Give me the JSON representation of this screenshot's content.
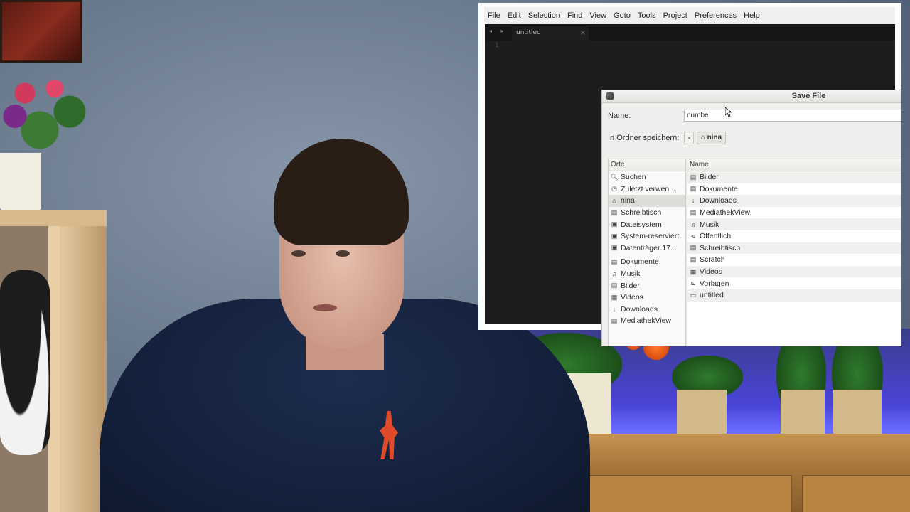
{
  "editor": {
    "menu": [
      "File",
      "Edit",
      "Selection",
      "Find",
      "View",
      "Goto",
      "Tools",
      "Project",
      "Preferences",
      "Help"
    ],
    "tab_nav": "◂ ▸",
    "tab": {
      "label": "untitled",
      "close": "×"
    },
    "line_numbers": [
      "1"
    ]
  },
  "dialog": {
    "title": "Save File",
    "name_label": "Name:",
    "name_value": "numbe",
    "folder_label": "In Ordner speichern:",
    "path_back": "◂",
    "path_current": "nina",
    "places_header": "Orte",
    "files_header": "Name",
    "places": [
      {
        "label": "Suchen",
        "icon": "search-icon"
      },
      {
        "label": "Zuletzt verwen...",
        "icon": "recent-icon"
      },
      {
        "label": "nina",
        "icon": "home-icon",
        "selected": true
      },
      {
        "label": "Schreibtisch",
        "icon": "desktop-folder-icon"
      },
      {
        "label": "Dateisystem",
        "icon": "drive-icon"
      },
      {
        "label": "System-reserviert",
        "icon": "drive-icon"
      },
      {
        "label": "Datenträger 17...",
        "icon": "drive-icon"
      },
      {
        "label": "Dokumente",
        "icon": "folder-icon",
        "separator_before": true
      },
      {
        "label": "Musik",
        "icon": "music-icon"
      },
      {
        "label": "Bilder",
        "icon": "pictures-icon"
      },
      {
        "label": "Videos",
        "icon": "video-icon"
      },
      {
        "label": "Downloads",
        "icon": "download-icon"
      },
      {
        "label": "MediathekView",
        "icon": "folder-icon"
      }
    ],
    "files": [
      {
        "label": "Bilder",
        "icon": "pictures-icon"
      },
      {
        "label": "Dokumente",
        "icon": "folder-icon"
      },
      {
        "label": "Downloads",
        "icon": "download-icon"
      },
      {
        "label": "MediathekView",
        "icon": "folder-icon"
      },
      {
        "label": "Musik",
        "icon": "music-icon"
      },
      {
        "label": "Öffentlich",
        "icon": "share-icon"
      },
      {
        "label": "Schreibtisch",
        "icon": "folder-icon"
      },
      {
        "label": "Scratch",
        "icon": "folder-icon"
      },
      {
        "label": "Videos",
        "icon": "video-icon"
      },
      {
        "label": "Vorlagen",
        "icon": "templates-icon"
      },
      {
        "label": "untitled",
        "icon": "file-icon"
      }
    ]
  },
  "colors": {
    "editor_bg": "#1c1c1c",
    "dialog_bg": "#eeeeec",
    "selection": "#dcdcd8"
  }
}
